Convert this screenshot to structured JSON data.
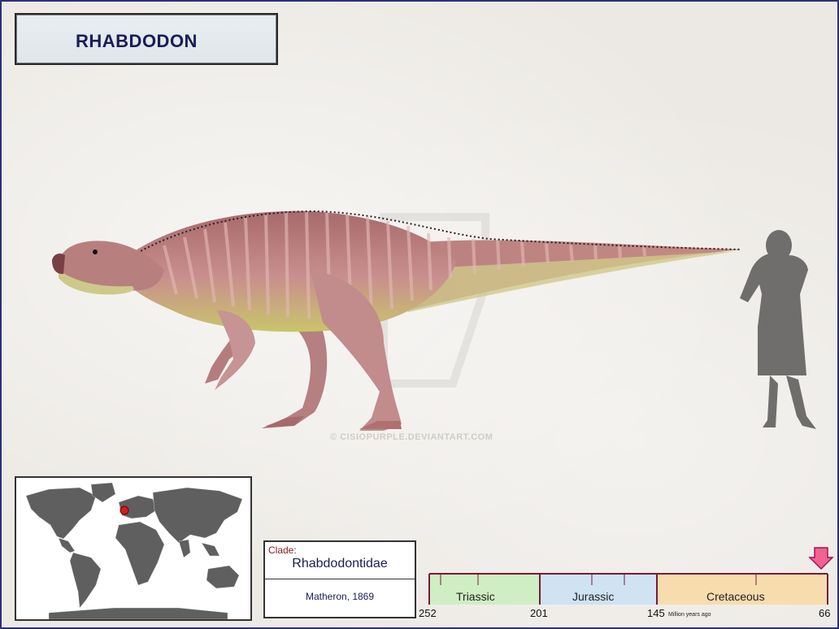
{
  "title": "RHABDODON",
  "watermark": "© CISIOPURPLE.DEVIANTART.COM",
  "clade": {
    "label": "Clade:",
    "name": "Rhabdodontidae",
    "author": "Matheron, 1869"
  },
  "timeline": {
    "periods": [
      {
        "name": "Triassic",
        "start": 252,
        "end": 201,
        "color": "#cfeec4"
      },
      {
        "name": "Jurassic",
        "start": 201,
        "end": 145,
        "color": "#cfe3f3"
      },
      {
        "name": "Cretaceous",
        "start": 145,
        "end": 66,
        "color": "#f7dcae"
      }
    ],
    "ticks": [
      "252",
      "201",
      "145",
      "66"
    ],
    "unit": "Million years ago",
    "marker_value": 66
  },
  "map": {
    "location_marker": "Europe"
  },
  "colors": {
    "frame": "#2c2f7a",
    "title_text": "#1a1d55",
    "marker": "#d61b1b",
    "arrow": "#f06292"
  }
}
